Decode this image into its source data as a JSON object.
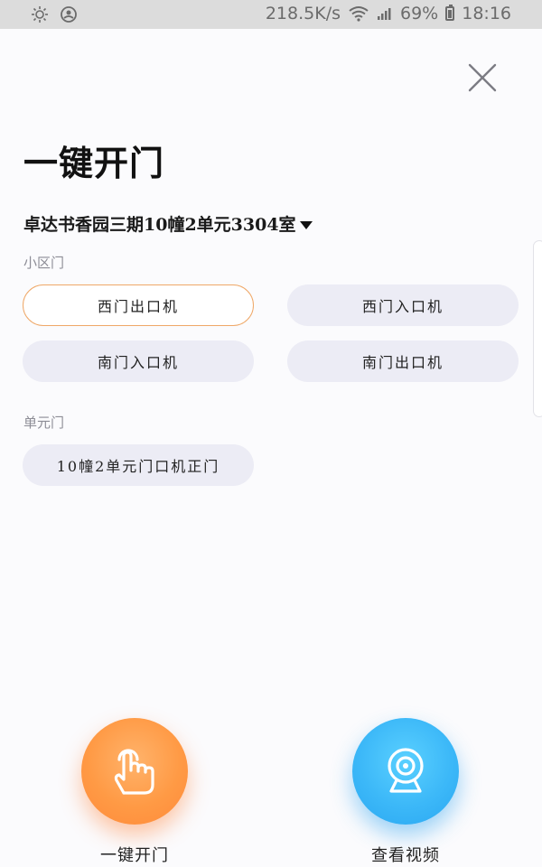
{
  "status_bar": {
    "speed": "218.5K/s",
    "battery": "69%",
    "time": "18:16",
    "icons": [
      "brightness-icon",
      "face-icon",
      "wifi-icon",
      "signal-icon",
      "battery-icon"
    ]
  },
  "page": {
    "title": "一键开门",
    "address": "卓达书香园三期10幢2单元3304室"
  },
  "sections": {
    "community_label": "小区门",
    "community_doors": [
      "西门出口机",
      "西门入口机",
      "南门入口机",
      "南门出口机"
    ],
    "unit_label": "单元门",
    "unit_doors": [
      "10幢2单元门口机正门"
    ]
  },
  "actions": {
    "open_label": "一键开门",
    "video_label": "查看视频"
  },
  "colors": {
    "selected_border": "#efa868",
    "orange": "#ff9a45",
    "blue": "#3cb8f8",
    "chip_bg": "#ececf5"
  }
}
